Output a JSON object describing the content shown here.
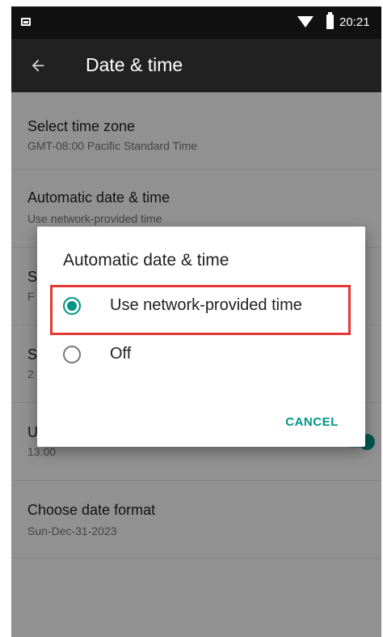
{
  "status_bar": {
    "time": "20:21",
    "icons": [
      "photo-icon",
      "wifi-icon",
      "battery-icon"
    ]
  },
  "toolbar": {
    "back_icon": "back-arrow-icon",
    "title": "Date & time"
  },
  "settings": {
    "timezone": {
      "title": "Select time zone",
      "summary": "GMT-08:00 Pacific Standard Time"
    },
    "auto_date_time": {
      "title": "Automatic date & time",
      "summary": "Use network-provided time"
    },
    "use_24_hour": {
      "title_partial": "U",
      "summary_partial": "13:00",
      "enabled": true
    },
    "date_format": {
      "title": "Choose date format",
      "summary": "Sun-Dec-31-2023"
    },
    "hidden_rows_partial": {
      "set_date_title": "S",
      "set_date_summary": "F",
      "set_time_title": "S",
      "set_time_summary": "2"
    }
  },
  "dialog": {
    "title": "Automatic date & time",
    "options": [
      {
        "label": "Use network-provided time",
        "selected": true
      },
      {
        "label": "Off",
        "selected": false
      }
    ],
    "cancel_label": "CANCEL"
  },
  "colors": {
    "accent": "#009688",
    "highlight": "#e53935",
    "toolbar": "#212121",
    "status_bar": "#111111"
  }
}
